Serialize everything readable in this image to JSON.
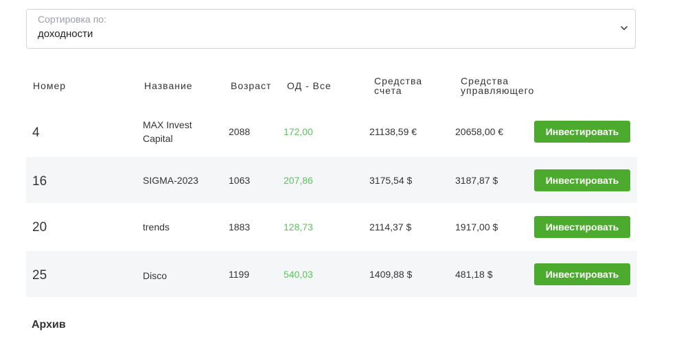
{
  "sort": {
    "label": "Сортировка по:",
    "value": "доходности"
  },
  "table": {
    "headers": {
      "number": "Номер",
      "name": "Название",
      "age": "Возраст",
      "yield": "ОД - Все",
      "account_funds_1": "Средства",
      "account_funds_2": "счета",
      "manager_funds_1": "Средства",
      "manager_funds_2": "управляющего"
    },
    "rows": [
      {
        "number": "4",
        "name_line1": "MAX Invest",
        "name_line2": "Capital",
        "age": "2088",
        "yield": "172,00",
        "account_funds": "21138,59 €",
        "manager_funds": "20658,00 €",
        "button": "Инвестировать"
      },
      {
        "number": "16",
        "name_line1": "SIGMA-2023",
        "name_line2": "",
        "age": "1063",
        "yield": "207,86",
        "account_funds": "3175,54 $",
        "manager_funds": "3187,87 $",
        "button": "Инвестировать"
      },
      {
        "number": "20",
        "name_line1": "trends",
        "name_line2": "",
        "age": "1883",
        "yield": "128,73",
        "account_funds": "2114,37 $",
        "manager_funds": "1917,00 $",
        "button": "Инвестировать"
      },
      {
        "number": "25",
        "name_line1": "Disco",
        "name_line2": "",
        "age": "1199",
        "yield": "540,03",
        "account_funds": "1409,88 $",
        "manager_funds": "481,18 $",
        "button": "Инвестировать"
      }
    ]
  },
  "archive": {
    "title": "Архив"
  },
  "colors": {
    "button_green": "#4caa2e",
    "yield_green": "#5cc35c",
    "row_shade": "#f5f6f8"
  },
  "icons": {
    "dropdown": "chevron-down-icon"
  }
}
